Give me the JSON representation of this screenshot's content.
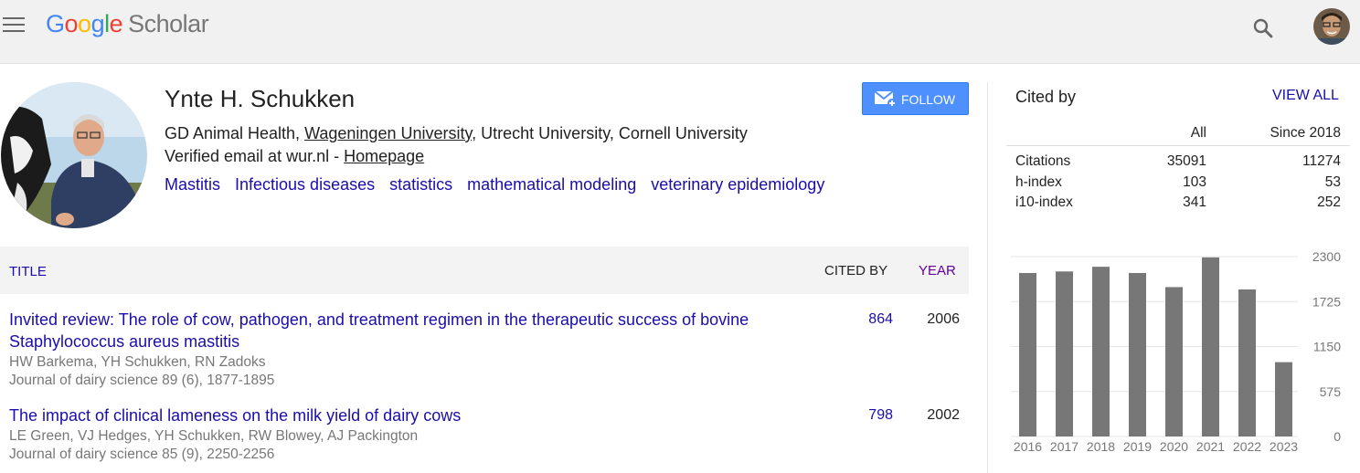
{
  "header": {
    "logo_letters": [
      "G",
      "o",
      "o",
      "g",
      "l",
      "e"
    ],
    "logo_product": "Scholar",
    "icons": [
      "menu-icon",
      "search-icon",
      "avatar"
    ]
  },
  "profile": {
    "name": "Ynte H. Schukken",
    "affiliation_parts": [
      "GD Animal Health, ",
      "Wageningen University",
      ", Utrecht University, Cornell University"
    ],
    "email_text": "Verified email at wur.nl - ",
    "homepage": "Homepage",
    "interests": [
      "Mastitis",
      "Infectious diseases",
      "statistics",
      "mathematical modeling",
      "veterinary epidemiology"
    ],
    "follow_label": "FOLLOW"
  },
  "table": {
    "col_title": "TITLE",
    "col_cited": "CITED BY",
    "col_year": "YEAR",
    "rows": [
      {
        "title": "Invited review: The role of cow, pathogen, and treatment regimen in the therapeutic success of bovine Staphylococcus aureus mastitis",
        "authors": "HW Barkema, YH Schukken, RN Zadoks",
        "journal": "Journal of dairy science 89 (6), 1877-1895",
        "cited": "864",
        "year": "2006"
      },
      {
        "title": "The impact of clinical lameness on the milk yield of dairy cows",
        "authors": "LE Green, VJ Hedges, YH Schukken, RW Blowey, AJ Packington",
        "journal": "Journal of dairy science 85 (9), 2250-2256",
        "cited": "798",
        "year": "2002"
      }
    ]
  },
  "citations": {
    "title": "Cited by",
    "view_all": "VIEW ALL",
    "col_all": "All",
    "col_since": "Since 2018",
    "rows": [
      {
        "label": "Citations",
        "all": "35091",
        "since": "11274"
      },
      {
        "label": "h-index",
        "all": "103",
        "since": "53"
      },
      {
        "label": "i10-index",
        "all": "341",
        "since": "252"
      }
    ]
  },
  "chart_data": {
    "type": "bar",
    "categories": [
      "2016",
      "2017",
      "2018",
      "2019",
      "2020",
      "2021",
      "2022",
      "2023"
    ],
    "values": [
      2090,
      2110,
      2170,
      2090,
      1910,
      2290,
      1880,
      950
    ],
    "yticks": [
      "2300",
      "1725",
      "1150",
      "575",
      "0"
    ],
    "ylim": [
      0,
      2300
    ],
    "bar_color": "#777777",
    "grid": true
  }
}
